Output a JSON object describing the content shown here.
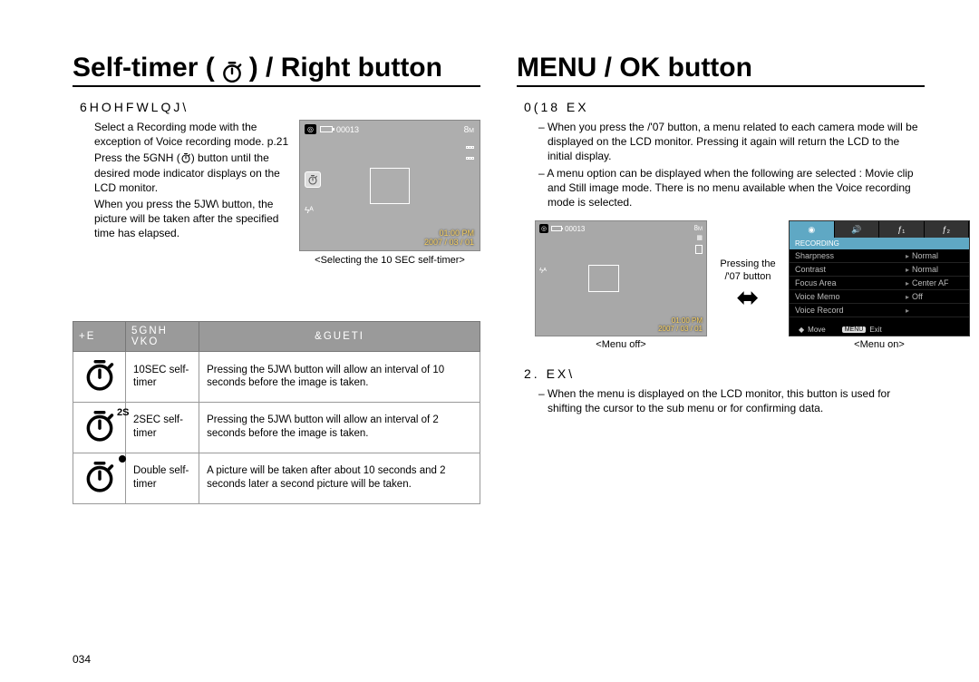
{
  "left": {
    "title_a": "Self-timer (",
    "title_b": ") / Right button",
    "sub_head": "6HOHFWLQJ\\",
    "p1": "Select a Recording mode with the exception of Voice recording mode. p.21",
    "p2a": "Press the  5GNH (",
    "p2b": ") button until the desired mode indicator displays on the LCD monitor.",
    "p3": "When you press the  5JW\\ button, the picture will be taken after the specified time has elapsed.",
    "lcd": {
      "count": "00013",
      "res": "8",
      "time": "01:00 PM",
      "date": "2007 / 03 / 01",
      "caption": "<Selecting the 10 SEC self-timer>"
    },
    "table": {
      "h1": "+E",
      "h2": "5GNH VKO",
      "h3": "&GUETI",
      "r1_mode": "10SEC self-timer",
      "r1_desc": "Pressing the  5JW\\ button will allow an interval of 10 seconds before the image is taken.",
      "r2_mode": "2SEC self-timer",
      "r2_sup": "2S",
      "r2_desc": "Pressing the  5JW\\ button will allow an interval of 2 seconds before the image is taken.",
      "r3_mode": "Double self-timer",
      "r3_desc": "A picture will be taken after about 10 seconds and 2 seconds later a second picture will be taken."
    }
  },
  "right": {
    "title": "MENU / OK button",
    "sub1": "0(18 EX",
    "b1": "– When you press the  /'07 button, a menu related to each camera mode will be displayed on the LCD monitor. Pressing it again will return the LCD to the initial display.",
    "b2": "– A menu option can be displayed when the following are selected : Movie clip and Still image mode. There is no menu available when the Voice recording mode is selected.",
    "press_label": "Pressing the /'07 button",
    "lcd_off": {
      "count": "00013",
      "res": "8",
      "time": "01:00 PM",
      "date": "2007 / 03 / 01",
      "caption": "<Menu off>"
    },
    "menu_on": {
      "section": "RECORDING",
      "rows": [
        {
          "lbl": "Sharpness",
          "val": "Normal"
        },
        {
          "lbl": "Contrast",
          "val": "Normal"
        },
        {
          "lbl": "Focus Area",
          "val": "Center AF"
        },
        {
          "lbl": "Voice Memo",
          "val": "Off"
        },
        {
          "lbl": "Voice Record",
          "val": ""
        }
      ],
      "foot_move": "Move",
      "foot_exit": "Exit",
      "foot_menu": "MENU",
      "tab_f1": "ƒ₁",
      "tab_f2": "ƒ₂",
      "caption": "<Menu on>"
    },
    "sub2": "2. EX\\",
    "b3": "– When the menu is displayed on the LCD monitor, this button is used for shifting the cursor to the sub menu or for confirming data."
  },
  "page_num": "034"
}
